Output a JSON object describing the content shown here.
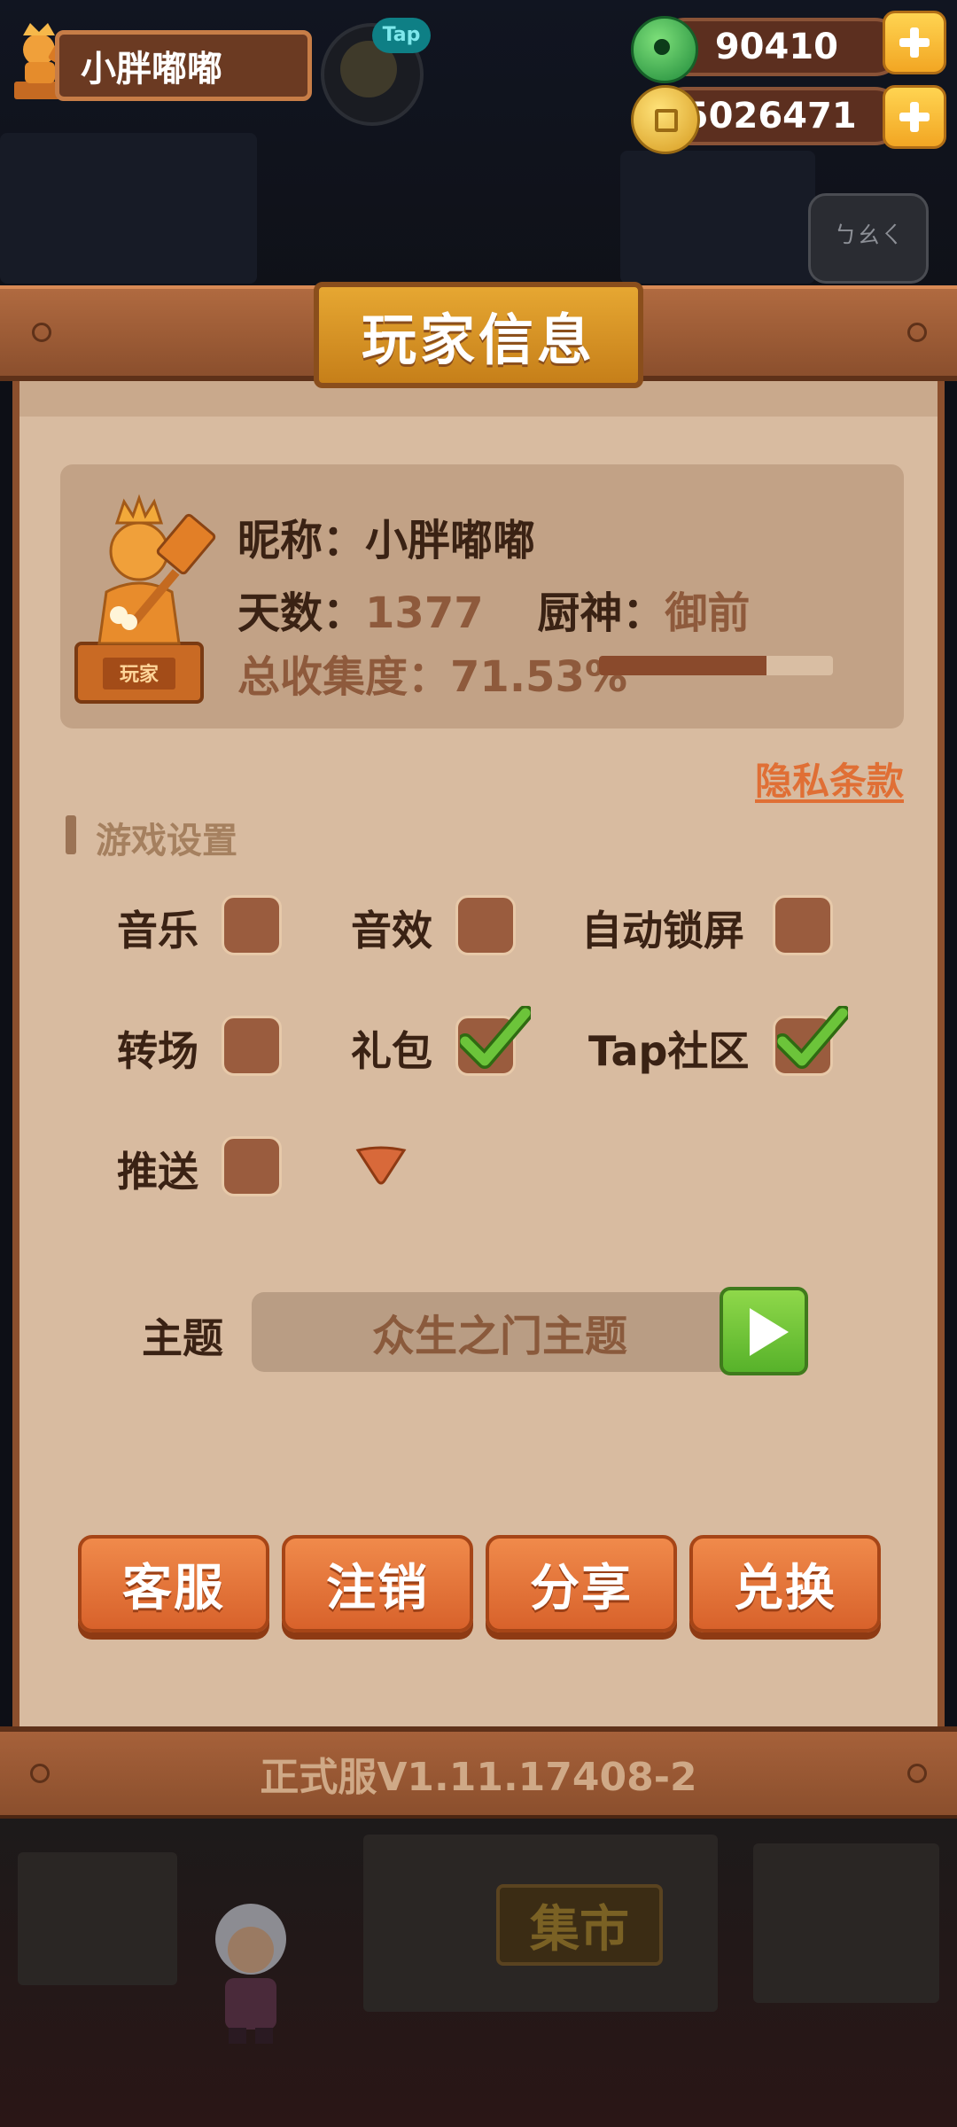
{
  "hud": {
    "player_name": "小胖嘟嘟",
    "tap_badge": "Tap",
    "jade_amount": "90410",
    "coin_amount": "35026471",
    "speech_text": "ㄅㄠㄑ"
  },
  "panel": {
    "title": "玩家信息",
    "statue_tag": "玩家",
    "nickname_label": "昵称：",
    "nickname_value": "小胖嘟嘟",
    "days_label": "天数：",
    "days_value": "1377",
    "chef_label": "厨神：",
    "chef_value": "御前",
    "collection_label": "总收集度：",
    "collection_value": "71.53%",
    "collection_progress": 0.7153,
    "privacy_link": "隐私条款",
    "settings_title": "游戏设置",
    "settings": [
      {
        "label": "音乐",
        "checked": false
      },
      {
        "label": "音效",
        "checked": false
      },
      {
        "label": "自动锁屏",
        "checked": false
      },
      {
        "label": "转场",
        "checked": false
      },
      {
        "label": "礼包",
        "checked": true
      },
      {
        "label": "Tap社区",
        "checked": true
      },
      {
        "label": "推送",
        "checked": false
      }
    ],
    "theme_label": "主题",
    "theme_value": "众生之门主题",
    "buttons": [
      "客服",
      "注销",
      "分享",
      "兑换"
    ],
    "version": "正式服V1.11.17408-2"
  },
  "scene": {
    "market_sign": "集市"
  },
  "colors": {
    "panel_bg": "#d8bba0",
    "wood": "#8b4f2d",
    "accent_orange": "#e06f35",
    "check_green": "#5cae2c",
    "title_gold": "#e6a732"
  },
  "icons": [
    "statue-icon",
    "jade-icon",
    "coin-icon",
    "plus-icon",
    "check-icon",
    "dropdown-arrow-icon",
    "play-icon"
  ]
}
